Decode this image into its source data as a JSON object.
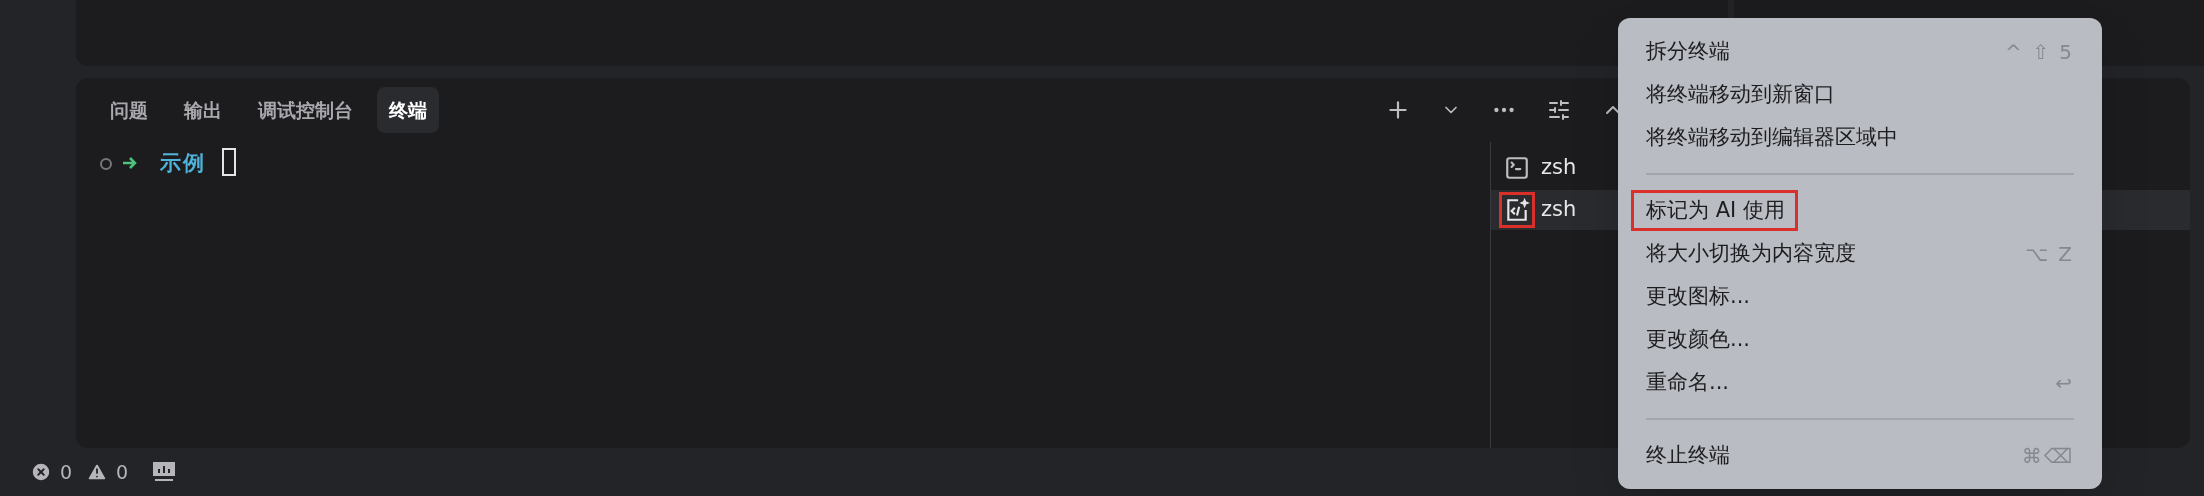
{
  "panel_tabs": [
    {
      "label": "问题",
      "selected": false
    },
    {
      "label": "输出",
      "selected": false
    },
    {
      "label": "调试控制台",
      "selected": false
    },
    {
      "label": "终端",
      "selected": true
    }
  ],
  "prompt": {
    "folder": "示例"
  },
  "terminals": [
    {
      "name": "zsh",
      "kind": "shell",
      "selected": false,
      "highlighted": false
    },
    {
      "name": "zsh",
      "kind": "ai",
      "selected": true,
      "highlighted": true
    }
  ],
  "context_menu": [
    {
      "kind": "item",
      "label": "拆分终端",
      "shortcut": "^ ⇧ 5",
      "highlighted": false
    },
    {
      "kind": "item",
      "label": "将终端移动到新窗口",
      "highlighted": false
    },
    {
      "kind": "item",
      "label": "将终端移动到编辑器区域中",
      "highlighted": false
    },
    {
      "kind": "separator"
    },
    {
      "kind": "item",
      "label": "标记为 AI 使用",
      "highlighted": true
    },
    {
      "kind": "item",
      "label": "将大小切换为内容宽度",
      "shortcut": "⌥ Z",
      "highlighted": false
    },
    {
      "kind": "item",
      "label": "更改图标...",
      "highlighted": false
    },
    {
      "kind": "item",
      "label": "更改颜色...",
      "highlighted": false
    },
    {
      "kind": "item",
      "label": "重命名...",
      "shortcut": "↩",
      "highlighted": false
    },
    {
      "kind": "separator"
    },
    {
      "kind": "item",
      "label": "终止终端",
      "shortcut": "⌘⌫",
      "highlighted": false
    }
  ],
  "status_bar": {
    "errors": "0",
    "warnings": "0"
  }
}
